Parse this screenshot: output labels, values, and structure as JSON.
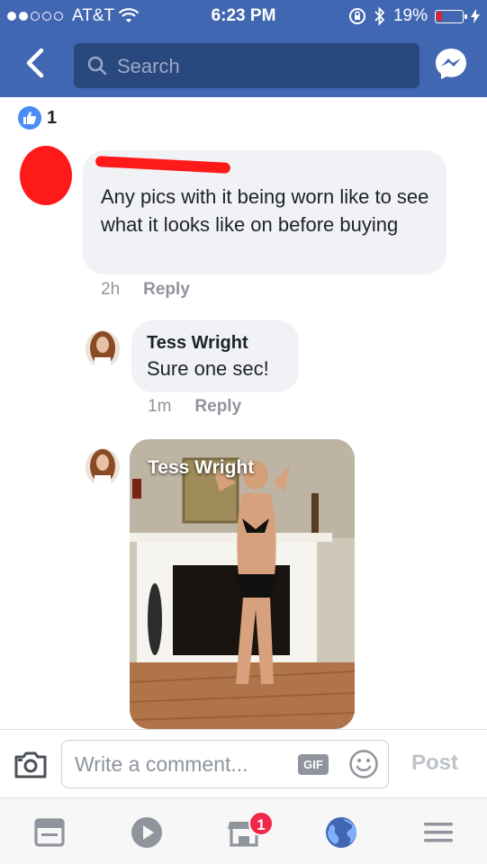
{
  "status_bar": {
    "carrier": "AT&T",
    "time": "6:23 PM",
    "battery": "19%"
  },
  "navbar": {
    "search_placeholder": "Search"
  },
  "likes": {
    "count": "1"
  },
  "comments": [
    {
      "text": "Any pics with it being worn like to see what it looks like on before buying",
      "time": "2h",
      "reply_label": "Reply"
    },
    {
      "author": "Tess Wright",
      "text": "Sure one sec!",
      "time": "1m",
      "reply_label": "Reply"
    },
    {
      "author": "Tess Wright",
      "type": "photo"
    }
  ],
  "composer": {
    "placeholder": "Write a comment...",
    "gif_label": "GIF",
    "post_label": "Post"
  },
  "tabbar": {
    "notifications_badge": "1"
  },
  "colors": {
    "brand": "#4267b2",
    "like_blue": "#4a8cf6",
    "badge_red": "#f02849"
  }
}
